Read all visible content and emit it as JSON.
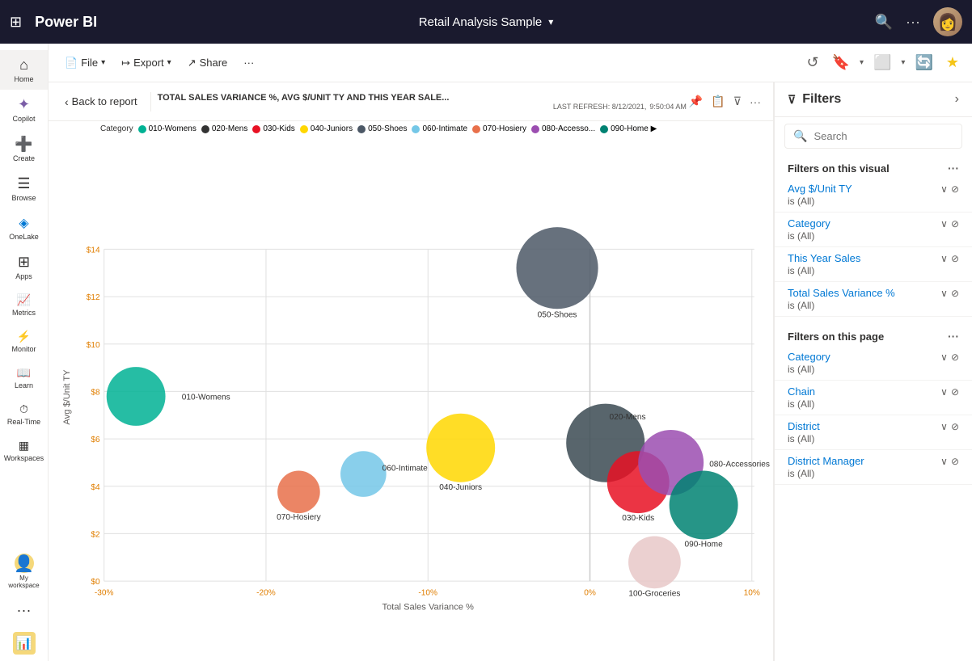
{
  "topNav": {
    "brand": "Power BI",
    "reportTitle": "Retail Analysis Sample",
    "chevronIcon": "▾",
    "waffleIcon": "⊞",
    "searchIcon": "🔍",
    "moreIcon": "···"
  },
  "sidebar": {
    "items": [
      {
        "id": "home",
        "icon": "⌂",
        "label": "Home"
      },
      {
        "id": "copilot",
        "icon": "✦",
        "label": "Copilot"
      },
      {
        "id": "create",
        "icon": "+",
        "label": "Create"
      },
      {
        "id": "browse",
        "icon": "☰",
        "label": "Browse"
      },
      {
        "id": "onelake",
        "icon": "◈",
        "label": "OneLake"
      },
      {
        "id": "apps",
        "icon": "⊞",
        "label": "Apps"
      },
      {
        "id": "metrics",
        "icon": "📊",
        "label": "Metrics"
      },
      {
        "id": "monitor",
        "icon": "⚡",
        "label": "Monitor"
      },
      {
        "id": "learn",
        "icon": "📖",
        "label": "Learn"
      },
      {
        "id": "realtime",
        "icon": "⏱",
        "label": "Real-Time"
      },
      {
        "id": "workspaces",
        "icon": "▦",
        "label": "Workspaces"
      },
      {
        "id": "myworkspace",
        "icon": "👤",
        "label": "My workspace"
      },
      {
        "id": "more",
        "icon": "···",
        "label": ""
      }
    ]
  },
  "toolbar": {
    "fileLabel": "File",
    "exportLabel": "Export",
    "shareLabel": "Share",
    "moreLabel": "···",
    "fileIcon": "📄",
    "exportIcon": "↦",
    "shareIcon": "↗"
  },
  "visualHeader": {
    "backLabel": "Back to report",
    "title": "TOTAL SALES VARIANCE %, AVG $/UNIT TY AND THIS YEAR SALE...",
    "lastRefresh": "LAST REFRESH: 8/12/2021,",
    "lastRefreshTime": "9:50:04 AM"
  },
  "chartLegend": {
    "categoryLabel": "Category",
    "items": [
      {
        "id": "010-Womens",
        "label": "010-Womens",
        "color": "#00b294"
      },
      {
        "id": "020-Mens",
        "label": "020-Mens",
        "color": "#333333"
      },
      {
        "id": "030-Kids",
        "label": "030-Kids",
        "color": "#e81123"
      },
      {
        "id": "040-Juniors",
        "label": "040-Juniors",
        "color": "#ffd700"
      },
      {
        "id": "050-Shoes",
        "label": "050-Shoes",
        "color": "#4c5866"
      },
      {
        "id": "060-Intimate",
        "label": "060-Intimate",
        "color": "#74c7e7"
      },
      {
        "id": "070-Hosiery",
        "label": "070-Hosiery",
        "color": "#e8704a"
      },
      {
        "id": "080-Accesso",
        "label": "080-Accesso...",
        "color": "#7b3f6e"
      },
      {
        "id": "090-Home",
        "label": "090-Home ▶",
        "color": "#008272"
      }
    ]
  },
  "chartData": {
    "xAxisLabel": "Total Sales Variance %",
    "yAxisLabel": "Avg $/Unit TY",
    "yTicks": [
      "$0",
      "$2",
      "$4",
      "$6",
      "$8",
      "$10",
      "$12",
      "$14"
    ],
    "xTicks": [
      "-30%",
      "-20%",
      "-10%",
      "0%",
      "10%"
    ],
    "bubbles": [
      {
        "id": "010-Womens",
        "label": "010-Womens",
        "x": -28,
        "y": 7.8,
        "size": 60,
        "color": "#00b294"
      },
      {
        "id": "020-Mens",
        "label": "020-Mens",
        "x": 1,
        "y": 5.8,
        "size": 85,
        "color": "#3b4a52"
      },
      {
        "id": "030-Kids",
        "label": "030-Kids",
        "x": 3,
        "y": 4.2,
        "size": 65,
        "color": "#e81123"
      },
      {
        "id": "040-Juniors",
        "label": "040-Juniors",
        "x": -8,
        "y": 5.6,
        "size": 80,
        "color": "#ffd700"
      },
      {
        "id": "050-Shoes",
        "label": "050-Shoes",
        "x": -2,
        "y": 13.2,
        "size": 100,
        "color": "#4c5866"
      },
      {
        "id": "060-Intimate",
        "label": "060-Intimate",
        "x": -14,
        "y": 4.5,
        "size": 45,
        "color": "#74c7e7"
      },
      {
        "id": "070-Hosiery",
        "label": "070-Hosiery",
        "x": -18,
        "y": 3.8,
        "size": 42,
        "color": "#e8704a"
      },
      {
        "id": "080-Accessories",
        "label": "080-Accessories",
        "x": 5,
        "y": 5.0,
        "size": 72,
        "color": "#9b4db0"
      },
      {
        "id": "090-Home",
        "label": "090-Home",
        "x": 7,
        "y": 3.2,
        "size": 75,
        "color": "#008272"
      },
      {
        "id": "100-Groceries",
        "label": "100-Groceries",
        "x": 4,
        "y": 0.8,
        "size": 55,
        "color": "#e8d0d0"
      }
    ]
  },
  "filters": {
    "title": "Filters",
    "searchPlaceholder": "Search",
    "visualFilters": {
      "title": "Filters on this visual",
      "items": [
        {
          "name": "Avg $/Unit TY",
          "value": "is (All)"
        },
        {
          "name": "Category",
          "value": "is (All)"
        },
        {
          "name": "This Year Sales",
          "value": "is (All)"
        },
        {
          "name": "Total Sales Variance %",
          "value": "is (All)"
        }
      ]
    },
    "pageFilters": {
      "title": "Filters on this page",
      "items": [
        {
          "name": "Category",
          "value": "is (All)"
        },
        {
          "name": "Chain",
          "value": "is (All)"
        },
        {
          "name": "District",
          "value": "is (All)"
        },
        {
          "name": "District Manager",
          "value": "is (All)"
        }
      ]
    }
  }
}
